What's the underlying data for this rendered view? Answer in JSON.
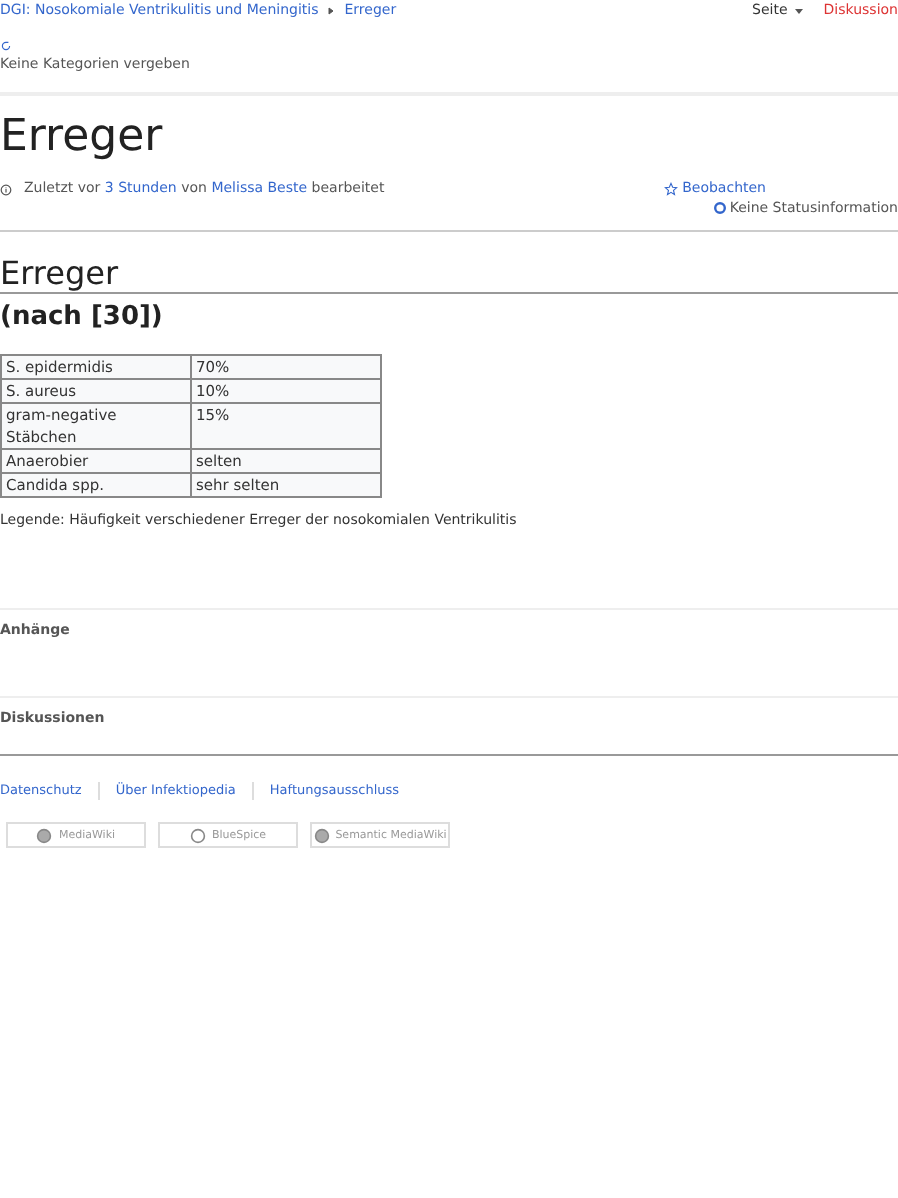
{
  "breadcrumb": {
    "items": [
      "DGI:  Nosokomiale Ventrikulitis und Meningitis",
      "Erreger"
    ]
  },
  "page_actions": {
    "menu": "Seite",
    "discussion": "Diskussion"
  },
  "categories": "Keine Kategorien vergeben",
  "title": "Erreger",
  "meta": {
    "prefix": "Zuletzt vor",
    "time": "3 Stunden",
    "by": "von",
    "author": "Melissa Beste",
    "suffix": "bearbeitet",
    "watch": "Beobachten",
    "status": "Keine Statusinformation"
  },
  "section": {
    "heading": "Erreger",
    "subheading": "(nach [30])",
    "table": {
      "rows": [
        [
          "S. epidermidis",
          "70%"
        ],
        [
          "S. aureus",
          "10%"
        ],
        [
          "gram-negative Stäbchen",
          "15%"
        ],
        [
          "Anaerobier",
          "selten"
        ],
        [
          "Candida spp.",
          "sehr selten"
        ]
      ]
    },
    "caption": "Legende: Häufigkeit verschiedener Erreger der nosokomialen Ventrikulitis"
  },
  "panels": [
    "Anhänge",
    "Diskussionen"
  ],
  "footer": {
    "links": [
      "Datenschutz",
      "Über Infektiopedia",
      "Haftungsausschluss"
    ],
    "badges": [
      "MediaWiki",
      "BlueSpice",
      "Semantic MediaWiki"
    ]
  }
}
